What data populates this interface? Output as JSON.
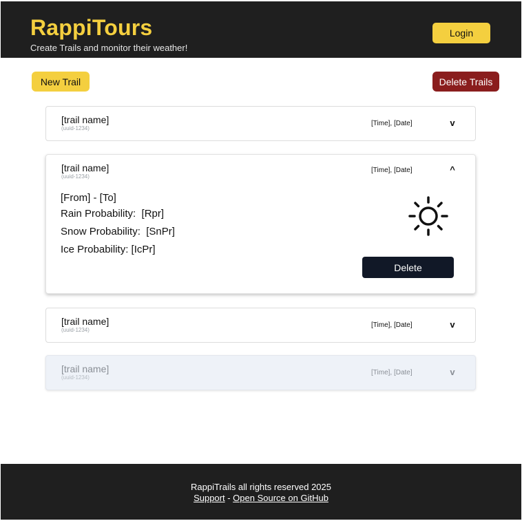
{
  "header": {
    "brand": "RappiTours",
    "tagline": "Create Trails and monitor their weather!",
    "login_label": "Login"
  },
  "toolbar": {
    "new_trail_label": "New Trail",
    "delete_trails_label": "Delete Trails"
  },
  "trails": [
    {
      "name": "[trail name]",
      "uuid": "(uuid-1234)",
      "time": "[Time], [Date]",
      "chevron": "v",
      "state": "collapsed"
    },
    {
      "name": "[trail name]",
      "uuid": "(uuid-1234)",
      "time": "[Time], [Date]",
      "chevron": "^",
      "state": "expanded",
      "from_to": "[From] - [To]",
      "rain": "Rain Probability:  [Rpr]",
      "snow": "Snow Probability:  [SnPr]",
      "ice": "Ice Probability: [IcPr]",
      "weather_icon": "sun-icon",
      "delete_label": "Delete"
    },
    {
      "name": "[trail name]",
      "uuid": "(uuid-1234)",
      "time": "[Time], [Date]",
      "chevron": "v",
      "state": "collapsed"
    },
    {
      "name": "[trail name]",
      "uuid": "(uuid-1234)",
      "time": "[Time], [Date]",
      "chevron": "v",
      "state": "muted"
    }
  ],
  "footer": {
    "rights": "RappiTrails all rights reserved 2025",
    "support_label": "Support",
    "separator": " - ",
    "github_label": "Open Source on GitHub"
  },
  "colors": {
    "header_bg": "#1f1f1f",
    "accent_yellow": "#f4cf3f",
    "danger_red": "#8a1d1d",
    "delete_navy": "#111827",
    "muted_card_bg": "#eef2f8"
  }
}
